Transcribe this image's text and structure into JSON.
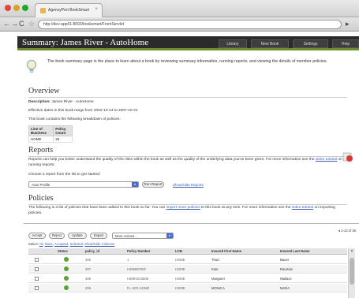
{
  "browser": {
    "tab_title": "AgencyPort BookSmart",
    "tab_close": "×",
    "url": "http://dev-app01:8003/booksmart/FrontServlet",
    "back": "←",
    "forward": "→",
    "reload": "C",
    "bookmark": "☆",
    "page_menu": "▸"
  },
  "header": {
    "title": "Summary: James River - AutoHome",
    "nav": [
      "Library",
      "New Book",
      "Settings",
      "Help"
    ]
  },
  "intro": {
    "text": "The book summary page is the place to learn about a book by reviewing summary information, running reports, and viewing the details of member policies."
  },
  "overview": {
    "title": "Overview",
    "description_label": "Description:",
    "description_value": "James River - AutoHome",
    "effective": "Effective dates in this book range from 2002-10-24 to 2007-10-21",
    "breakdown": "This book contains the following breakdown of policies:",
    "table": {
      "headers": [
        "Line of Business",
        "Policy Count"
      ],
      "rows": [
        [
          "HOME",
          "26"
        ]
      ]
    }
  },
  "reports": {
    "title": "Reports",
    "text_1": "Reports can help you better understand the quality of the risks within the book as well as the quality of the underlying data you've been given. For more information see the",
    "link": "video tutorial",
    "text_2": "on running reports.",
    "choose": "Choose a report from the list to get started:",
    "selected": "Auto Profile",
    "run_button": "Run Report",
    "show_hide": "Show/Hide Reports"
  },
  "policies": {
    "title": "Policies",
    "text_1": "The following is a list of policies that have been added to this book so far. You can",
    "link_import": "import more policies",
    "text_2": "to this book at any time. For more information see the",
    "link_video": "video tutorial",
    "text_3": "on importing policies.",
    "pager": "◂ 1-13 of 26",
    "buttons": [
      "Accept",
      "Reject",
      "Update",
      "Export"
    ],
    "more_actions": "More Actions...",
    "select_label": "Select:",
    "select_links": [
      "All",
      "None",
      "Accepted",
      "Selected",
      "Show/Hide Columns"
    ],
    "columns": [
      "Status",
      "policy_id",
      "Policy Number",
      "LOB",
      "Insured First Name",
      "Insured Last Name"
    ],
    "rows": [
      {
        "id": "406",
        "number": "1",
        "lob": "HOME",
        "first": "Thad",
        "last": "Bauer"
      },
      {
        "id": "407",
        "number": "H48599795F",
        "lob": "HOME",
        "first": "Kate",
        "last": "Rauision"
      },
      {
        "id": "408",
        "number": "H48R1012808",
        "lob": "HOME",
        "first": "Margaret",
        "last": "Wallace"
      },
      {
        "id": "409",
        "number": "FL HO3 HOME",
        "lob": "HOME",
        "first": "MONICA",
        "last": "MARA"
      }
    ]
  },
  "colors": {
    "header_bg": "#2b2b2b",
    "accent": "#6d8c2e",
    "link": "#3b5fb5",
    "status_ok": "#55a630"
  }
}
